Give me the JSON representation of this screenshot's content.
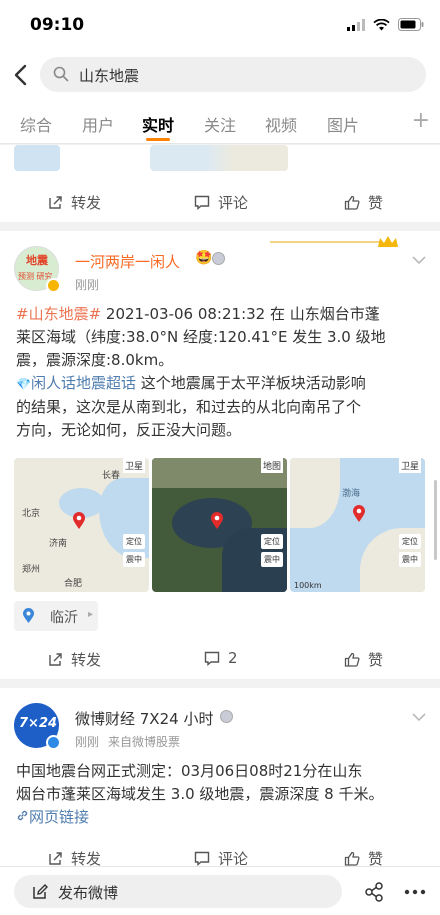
{
  "status": {
    "time": "09:10"
  },
  "search": {
    "query": "山东地震"
  },
  "tabs": [
    {
      "label": "综合"
    },
    {
      "label": "用户"
    },
    {
      "label": "实时"
    },
    {
      "label": "关注"
    },
    {
      "label": "视频"
    },
    {
      "label": "图片"
    }
  ],
  "tabs_more": "+",
  "post0": {
    "repost": "转发",
    "comment": "评论",
    "like": "赞"
  },
  "post1": {
    "avatar_text_top": "地震",
    "avatar_text_bottom": "预测 研究",
    "username": "一河两岸一闲人",
    "time": "刚刚",
    "topic": "#山东地震#",
    "line1_rest": " 2021-03-06 08:21:32 在 山东烟台市蓬",
    "line2": "莱区海域（纬度:38.0°N 经度:120.41°E 发生 3.0 级地",
    "line3": "震，震源深度:8.0km。",
    "supertopic": "闲人话地震超话",
    "line4_rest": " 这个地震属于太平洋板块活动影响",
    "line5": "的结果，这次是从南到北，和过去的从北向南吊了个",
    "line6": "方向，无论如何，反正没大问题。",
    "location": "临沂",
    "repost": "转发",
    "comment_count": "2",
    "like": "赞",
    "maps": [
      {
        "labels": [
          "卫星",
          "北京",
          "济南",
          "长春",
          "郑州",
          "合肥",
          "定位",
          "震中"
        ]
      },
      {
        "labels": [
          "地图",
          "定位",
          "震中"
        ]
      },
      {
        "labels": [
          "卫星",
          "渤海",
          "定位",
          "震中",
          "100km"
        ]
      }
    ]
  },
  "post2": {
    "avatar_text": "7×24",
    "username": "微博财经 7X24 小时",
    "time": "刚刚",
    "source": "来自微博股票",
    "line1": "中国地震台网正式测定：03月06日08时21分在山东",
    "line2": "烟台市蓬莱区海域发生 3.0 级地震，震源深度 8 千米。",
    "weblink": "网页链接",
    "repost": "转发",
    "comment": "评论",
    "like": "赞"
  },
  "bottom": {
    "post_label": "发布微博"
  },
  "colors": {
    "accent": "#ff8200",
    "link": "#eb7350",
    "link_blue": "#507daf",
    "name_orange": "#f86a24"
  }
}
